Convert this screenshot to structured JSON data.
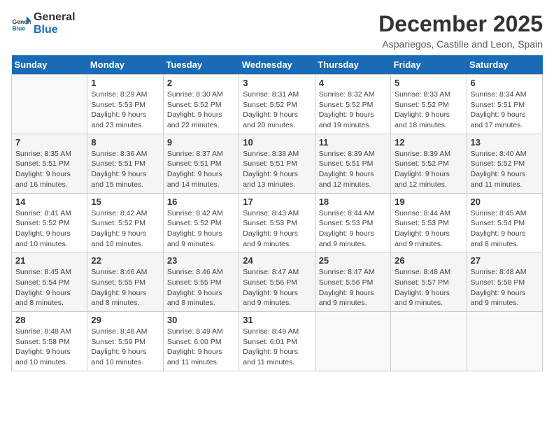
{
  "logo": {
    "line1": "General",
    "line2": "Blue"
  },
  "title": "December 2025",
  "location": "Aspariegos, Castille and Leon, Spain",
  "days_of_week": [
    "Sunday",
    "Monday",
    "Tuesday",
    "Wednesday",
    "Thursday",
    "Friday",
    "Saturday"
  ],
  "weeks": [
    [
      {
        "day": "",
        "info": ""
      },
      {
        "day": "1",
        "info": "Sunrise: 8:29 AM\nSunset: 5:53 PM\nDaylight: 9 hours\nand 23 minutes."
      },
      {
        "day": "2",
        "info": "Sunrise: 8:30 AM\nSunset: 5:52 PM\nDaylight: 9 hours\nand 22 minutes."
      },
      {
        "day": "3",
        "info": "Sunrise: 8:31 AM\nSunset: 5:52 PM\nDaylight: 9 hours\nand 20 minutes."
      },
      {
        "day": "4",
        "info": "Sunrise: 8:32 AM\nSunset: 5:52 PM\nDaylight: 9 hours\nand 19 minutes."
      },
      {
        "day": "5",
        "info": "Sunrise: 8:33 AM\nSunset: 5:52 PM\nDaylight: 9 hours\nand 18 minutes."
      },
      {
        "day": "6",
        "info": "Sunrise: 8:34 AM\nSunset: 5:51 PM\nDaylight: 9 hours\nand 17 minutes."
      }
    ],
    [
      {
        "day": "7",
        "info": "Sunrise: 8:35 AM\nSunset: 5:51 PM\nDaylight: 9 hours\nand 16 minutes."
      },
      {
        "day": "8",
        "info": "Sunrise: 8:36 AM\nSunset: 5:51 PM\nDaylight: 9 hours\nand 15 minutes."
      },
      {
        "day": "9",
        "info": "Sunrise: 8:37 AM\nSunset: 5:51 PM\nDaylight: 9 hours\nand 14 minutes."
      },
      {
        "day": "10",
        "info": "Sunrise: 8:38 AM\nSunset: 5:51 PM\nDaylight: 9 hours\nand 13 minutes."
      },
      {
        "day": "11",
        "info": "Sunrise: 8:39 AM\nSunset: 5:51 PM\nDaylight: 9 hours\nand 12 minutes."
      },
      {
        "day": "12",
        "info": "Sunrise: 8:39 AM\nSunset: 5:52 PM\nDaylight: 9 hours\nand 12 minutes."
      },
      {
        "day": "13",
        "info": "Sunrise: 8:40 AM\nSunset: 5:52 PM\nDaylight: 9 hours\nand 11 minutes."
      }
    ],
    [
      {
        "day": "14",
        "info": "Sunrise: 8:41 AM\nSunset: 5:52 PM\nDaylight: 9 hours\nand 10 minutes."
      },
      {
        "day": "15",
        "info": "Sunrise: 8:42 AM\nSunset: 5:52 PM\nDaylight: 9 hours\nand 10 minutes."
      },
      {
        "day": "16",
        "info": "Sunrise: 8:42 AM\nSunset: 5:52 PM\nDaylight: 9 hours\nand 9 minutes."
      },
      {
        "day": "17",
        "info": "Sunrise: 8:43 AM\nSunset: 5:53 PM\nDaylight: 9 hours\nand 9 minutes."
      },
      {
        "day": "18",
        "info": "Sunrise: 8:44 AM\nSunset: 5:53 PM\nDaylight: 9 hours\nand 9 minutes."
      },
      {
        "day": "19",
        "info": "Sunrise: 8:44 AM\nSunset: 5:53 PM\nDaylight: 9 hours\nand 9 minutes."
      },
      {
        "day": "20",
        "info": "Sunrise: 8:45 AM\nSunset: 5:54 PM\nDaylight: 9 hours\nand 8 minutes."
      }
    ],
    [
      {
        "day": "21",
        "info": "Sunrise: 8:45 AM\nSunset: 5:54 PM\nDaylight: 9 hours\nand 8 minutes."
      },
      {
        "day": "22",
        "info": "Sunrise: 8:46 AM\nSunset: 5:55 PM\nDaylight: 9 hours\nand 8 minutes."
      },
      {
        "day": "23",
        "info": "Sunrise: 8:46 AM\nSunset: 5:55 PM\nDaylight: 9 hours\nand 8 minutes."
      },
      {
        "day": "24",
        "info": "Sunrise: 8:47 AM\nSunset: 5:56 PM\nDaylight: 9 hours\nand 9 minutes."
      },
      {
        "day": "25",
        "info": "Sunrise: 8:47 AM\nSunset: 5:56 PM\nDaylight: 9 hours\nand 9 minutes."
      },
      {
        "day": "26",
        "info": "Sunrise: 8:48 AM\nSunset: 5:57 PM\nDaylight: 9 hours\nand 9 minutes."
      },
      {
        "day": "27",
        "info": "Sunrise: 8:48 AM\nSunset: 5:58 PM\nDaylight: 9 hours\nand 9 minutes."
      }
    ],
    [
      {
        "day": "28",
        "info": "Sunrise: 8:48 AM\nSunset: 5:58 PM\nDaylight: 9 hours\nand 10 minutes."
      },
      {
        "day": "29",
        "info": "Sunrise: 8:48 AM\nSunset: 5:59 PM\nDaylight: 9 hours\nand 10 minutes."
      },
      {
        "day": "30",
        "info": "Sunrise: 8:49 AM\nSunset: 6:00 PM\nDaylight: 9 hours\nand 11 minutes."
      },
      {
        "day": "31",
        "info": "Sunrise: 8:49 AM\nSunset: 6:01 PM\nDaylight: 9 hours\nand 11 minutes."
      },
      {
        "day": "",
        "info": ""
      },
      {
        "day": "",
        "info": ""
      },
      {
        "day": "",
        "info": ""
      }
    ]
  ]
}
